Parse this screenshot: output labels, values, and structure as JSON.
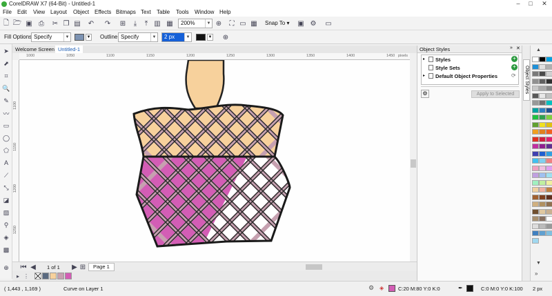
{
  "window": {
    "title": "CorelDRAW X7 (64-Bit) - Untitled-1",
    "controls": [
      "minimize",
      "maximize",
      "close"
    ]
  },
  "menu": [
    "File",
    "Edit",
    "View",
    "Layout",
    "Object",
    "Effects",
    "Bitmaps",
    "Text",
    "Table",
    "Tools",
    "Window",
    "Help"
  ],
  "toolbar": {
    "zoom_value": "200%",
    "snap_to_label": "Snap To"
  },
  "property_bar": {
    "fill_label": "Fill Options:",
    "fill_value": "Specify",
    "outline_label": "Outline:",
    "outline_value": "Specify",
    "width_value": "2 px"
  },
  "tabs": {
    "welcome": "Welcome Screen",
    "document": "Untitled-1"
  },
  "ruler": {
    "h_ticks": [
      "1000",
      "1050",
      "1100",
      "1150",
      "1200",
      "1250",
      "1300",
      "1350",
      "1400",
      "1450",
      "pixels"
    ],
    "v_ticks": [
      "1100",
      "1150",
      "1200",
      "1250"
    ]
  },
  "page_nav": {
    "counter": "1 of 1",
    "page_tab": "Page 1"
  },
  "docker": {
    "header": "Object Styles",
    "items": [
      "Styles",
      "Style Sets",
      "Default Object Properties"
    ],
    "apply_button": "Apply to Selected",
    "side_tab": "Object Styles"
  },
  "status": {
    "coords": "( 1,443 , 1,169 )",
    "object_info": "Curve on Layer 1",
    "fill_info": "C:20 M:80 Y:0 K:0",
    "outline_info": "C:0 M:0 Y:0 K:100",
    "outline_width": "2 px"
  },
  "colors": {
    "skin": "#f7d19c",
    "magenta": "#d35db5",
    "mauve": "#c6a0b0",
    "outline": "#222222",
    "fill_swatch": "#d35db5"
  },
  "doc_palette": [
    "#ffffff",
    "#f7d19c",
    "#c6a0b0",
    "#d35db5",
    "#1a1a1a"
  ],
  "color_palette": [
    "#ffffff",
    "#000000",
    "#00a0e0",
    "#1e90d8",
    "#e0e0e0",
    "#b0b0b0",
    "#7a7a7a",
    "#4a4a4a",
    "#d0d0d0",
    "#909090",
    "#606060",
    "#303030",
    "#c8c8c8",
    "#a8a8a8",
    "#888888",
    "#585858",
    "#e8e8e8",
    "#c0c0c0",
    "#989898",
    "#707070",
    "#00c0c0",
    "#00a0a0",
    "#3080c0",
    "#205090",
    "#20c040",
    "#30a050",
    "#80d040",
    "#60a030",
    "#f0e020",
    "#e0c010",
    "#f0a020",
    "#e08020",
    "#f06020",
    "#e03020",
    "#d02040",
    "#e02070",
    "#c030a0",
    "#902090",
    "#603090",
    "#4040b0",
    "#2060d0",
    "#30a0e0",
    "#40c0f0",
    "#80d0f0",
    "#f08080",
    "#f0a0c0",
    "#f0c0e0",
    "#e0a0f0",
    "#c0a0e0",
    "#a0c0f0",
    "#a0e0f0",
    "#a0f0c0",
    "#c0f0a0",
    "#f0f0a0",
    "#f0d0a0",
    "#f0b0a0",
    "#c08040",
    "#a06030",
    "#804020",
    "#603020",
    "#d0b080",
    "#b09060",
    "#907050",
    "#705030",
    "#e0c8a0",
    "#c8b090",
    "#a89070",
    "#887060",
    "#ffffff",
    "#dddddd",
    "#bbbbbb",
    "#999999",
    "#4080c0",
    "#60a0d0",
    "#80c0e0",
    "#a0d8f0"
  ]
}
